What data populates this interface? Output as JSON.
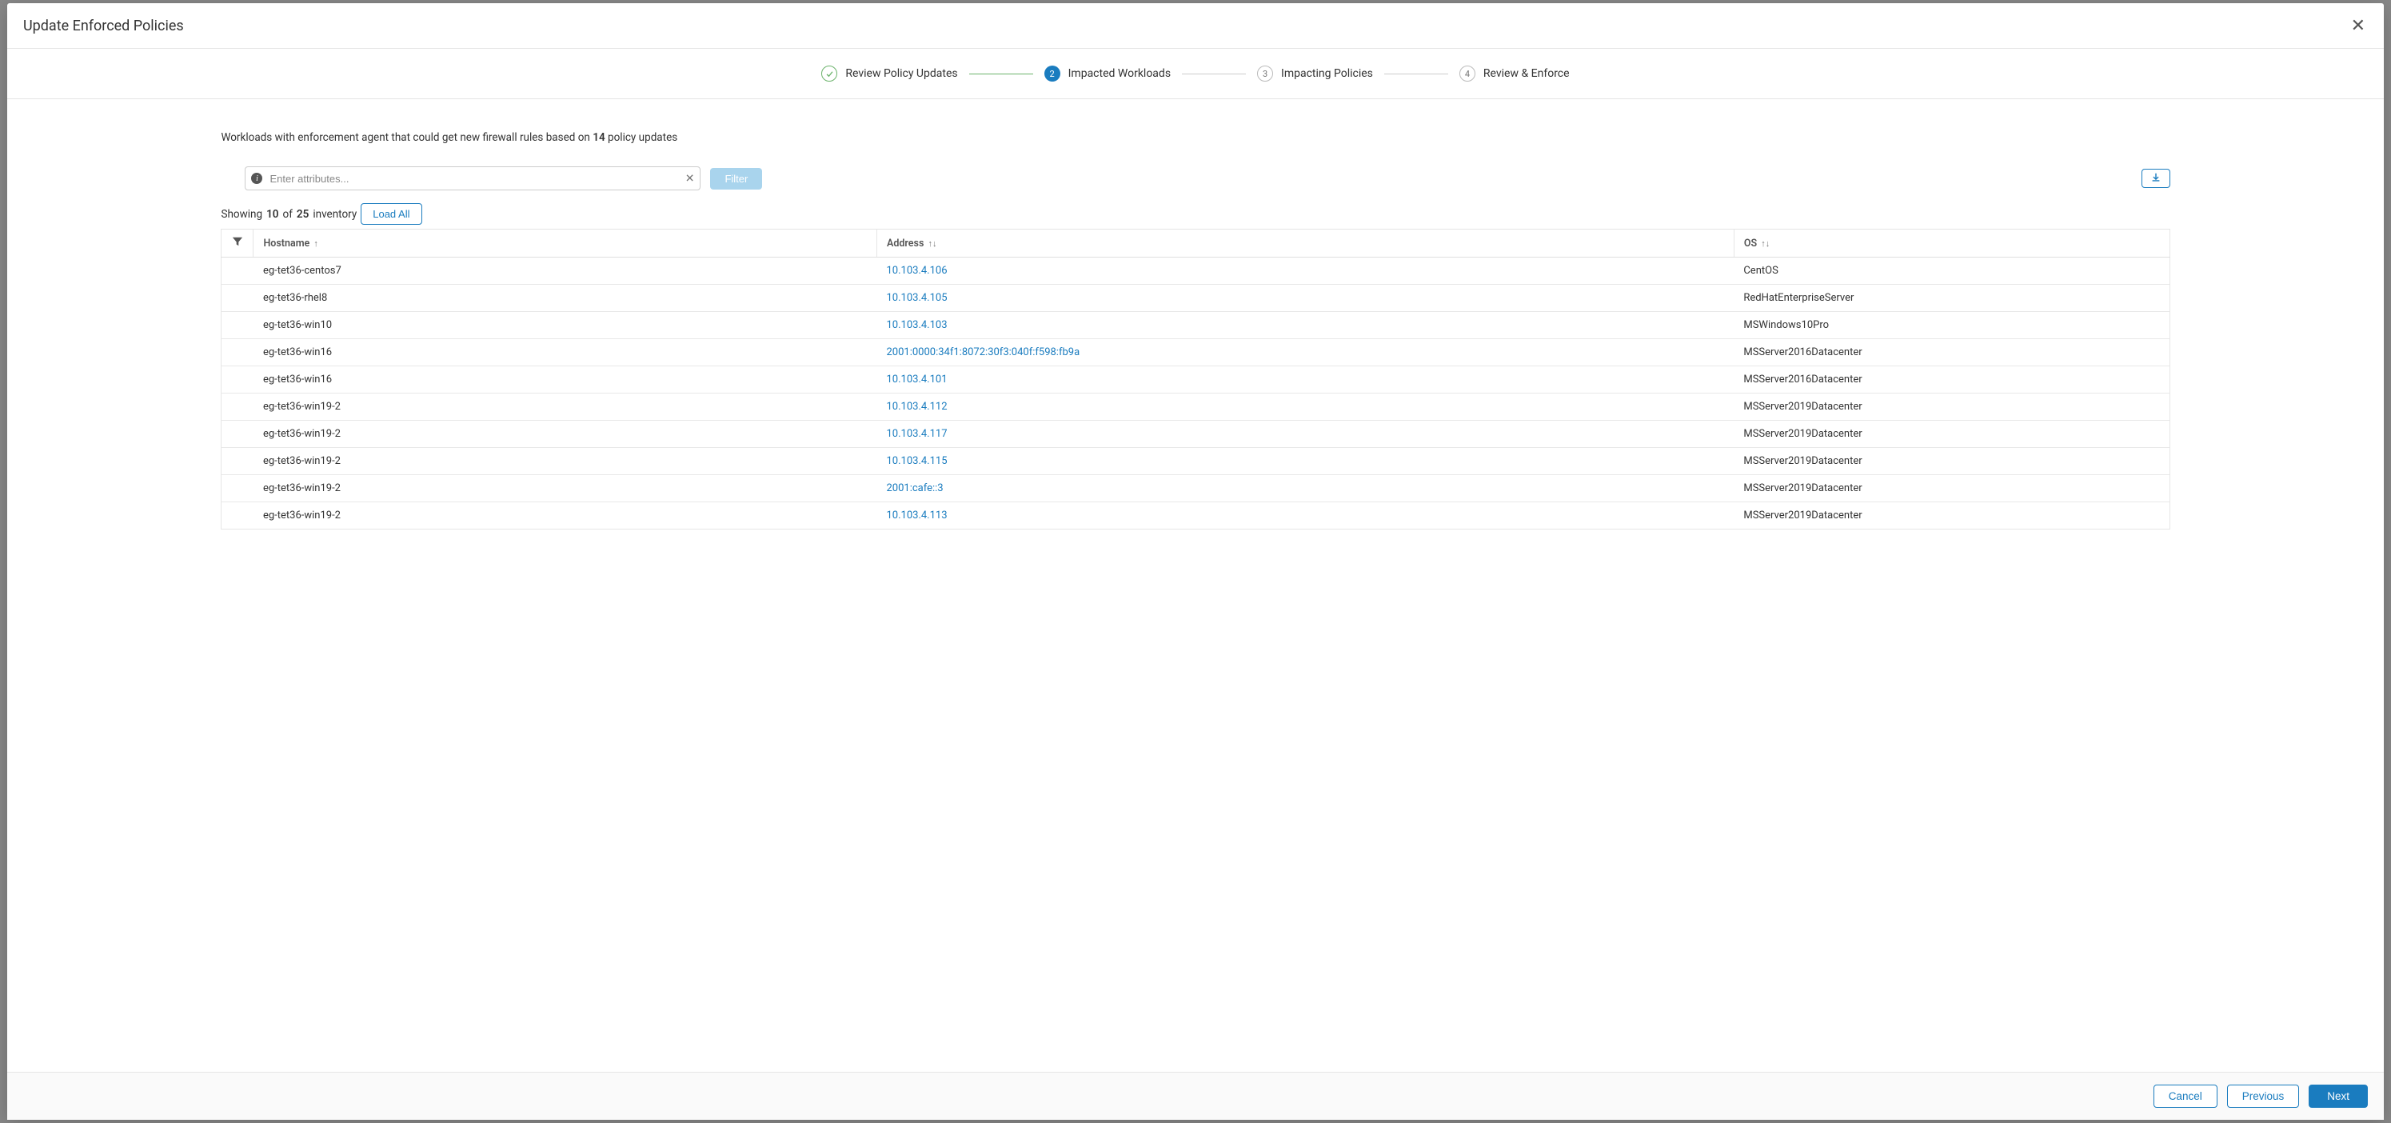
{
  "modal": {
    "title": "Update Enforced Policies"
  },
  "stepper": {
    "steps": [
      {
        "num": "",
        "label": "Review Policy Updates"
      },
      {
        "num": "2",
        "label": "Impacted Workloads"
      },
      {
        "num": "3",
        "label": "Impacting Policies"
      },
      {
        "num": "4",
        "label": "Review & Enforce"
      }
    ]
  },
  "body": {
    "desc_prefix": "Workloads with enforcement agent that could get new firewall rules based on ",
    "desc_count": "14",
    "desc_suffix": " policy updates",
    "filter_placeholder": "Enter attributes...",
    "filter_button": "Filter",
    "showing_prefix": "Showing ",
    "showing_shown": "10",
    "showing_of": " of ",
    "showing_total": "25",
    "showing_suffix": " inventory",
    "load_all": "Load All"
  },
  "table": {
    "headers": {
      "hostname": "Hostname",
      "address": "Address",
      "os": "OS"
    },
    "rows": [
      {
        "hostname": "eg-tet36-centos7",
        "address": "10.103.4.106",
        "os": "CentOS"
      },
      {
        "hostname": "eg-tet36-rhel8",
        "address": "10.103.4.105",
        "os": "RedHatEnterpriseServer"
      },
      {
        "hostname": "eg-tet36-win10",
        "address": "10.103.4.103",
        "os": "MSWindows10Pro"
      },
      {
        "hostname": "eg-tet36-win16",
        "address": "2001:0000:34f1:8072:30f3:040f:f598:fb9a",
        "os": "MSServer2016Datacenter"
      },
      {
        "hostname": "eg-tet36-win16",
        "address": "10.103.4.101",
        "os": "MSServer2016Datacenter"
      },
      {
        "hostname": "eg-tet36-win19-2",
        "address": "10.103.4.112",
        "os": "MSServer2019Datacenter"
      },
      {
        "hostname": "eg-tet36-win19-2",
        "address": "10.103.4.117",
        "os": "MSServer2019Datacenter"
      },
      {
        "hostname": "eg-tet36-win19-2",
        "address": "10.103.4.115",
        "os": "MSServer2019Datacenter"
      },
      {
        "hostname": "eg-tet36-win19-2",
        "address": "2001:cafe::3",
        "os": "MSServer2019Datacenter"
      },
      {
        "hostname": "eg-tet36-win19-2",
        "address": "10.103.4.113",
        "os": "MSServer2019Datacenter"
      }
    ]
  },
  "footer": {
    "cancel": "Cancel",
    "previous": "Previous",
    "next": "Next"
  }
}
